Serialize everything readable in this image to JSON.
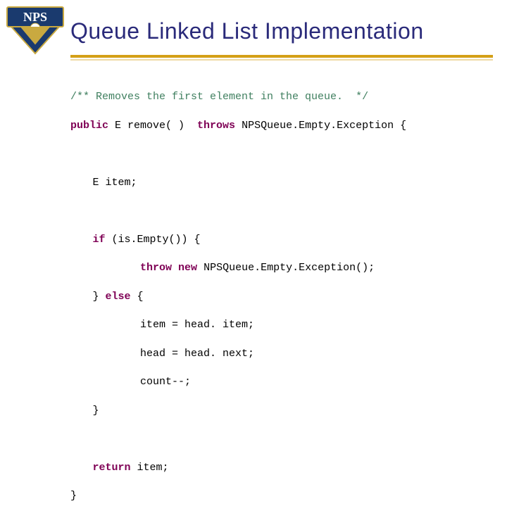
{
  "title": "Queue Linked List Implementation",
  "code": {
    "l1_cmt": "/** Removes the first element in the queue.  */",
    "l2_kw1": "public",
    "l2_mid": " E remove( )  ",
    "l2_kw2": "throws",
    "l2_end": " NPSQueue.Empty.Exception {",
    "l3": "E item;",
    "l4_kw": "if",
    "l4_rest": " (is.Empty()) {",
    "l5_kw1": "throw",
    "l5_sp": " ",
    "l5_kw2": "new",
    "l5_rest": " NPSQueue.Empty.Exception();",
    "l6a": "} ",
    "l6_kw": "else",
    "l6b": " {",
    "l7": "item = head. item;",
    "l8": "head = head. next;",
    "l9": "count--;",
    "l10": "}",
    "l11_kw": "return",
    "l11_rest": " item;",
    "l12": "}"
  }
}
